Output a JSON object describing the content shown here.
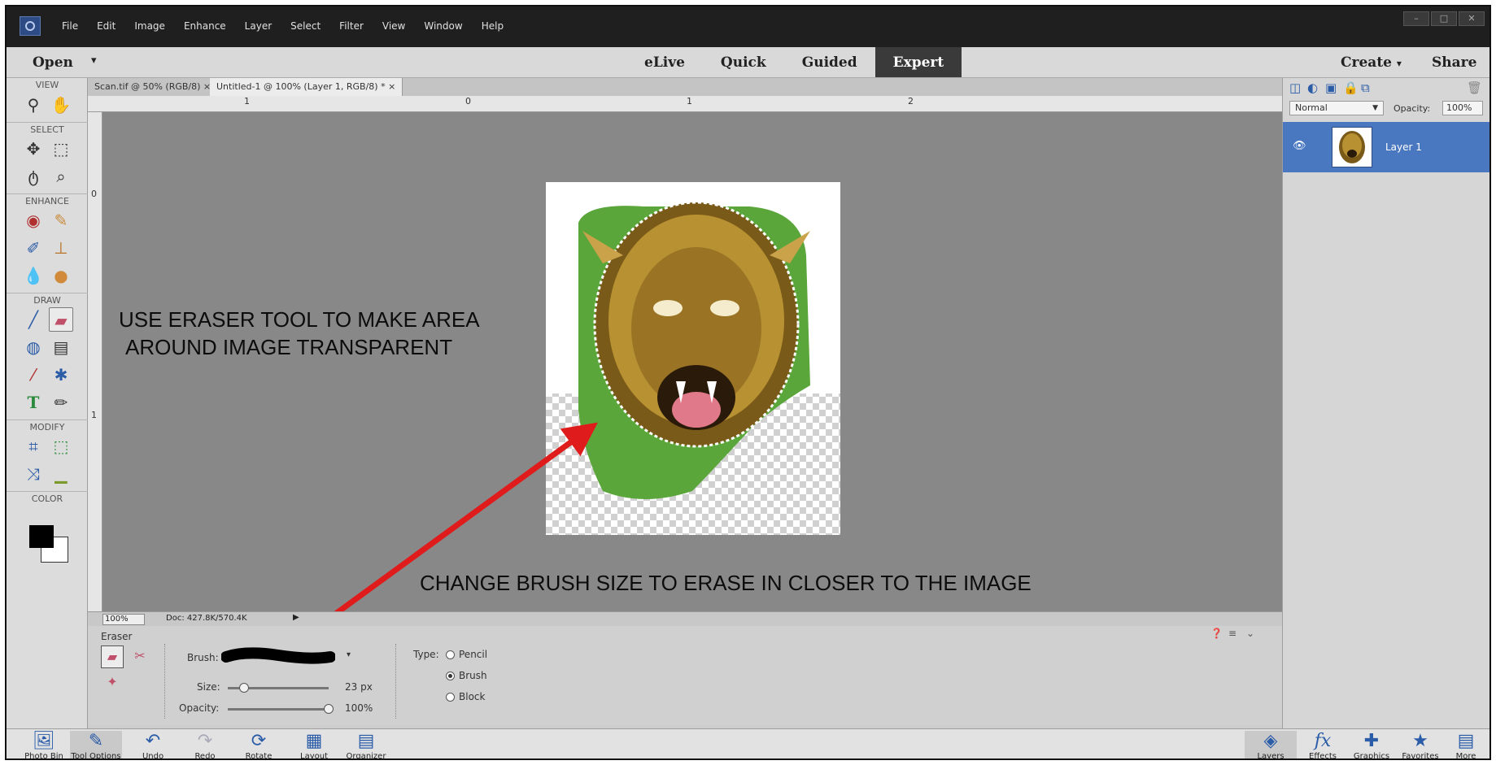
{
  "menubar": {
    "items": [
      "File",
      "Edit",
      "Image",
      "Enhance",
      "Layer",
      "Select",
      "Filter",
      "View",
      "Window",
      "Help"
    ]
  },
  "modebar": {
    "open_label": "Open",
    "modes": [
      "eLive",
      "Quick",
      "Guided",
      "Expert"
    ],
    "active_mode": "Expert",
    "create_label": "Create",
    "share_label": "Share"
  },
  "toolbox": {
    "sections": [
      "VIEW",
      "SELECT",
      "ENHANCE",
      "DRAW",
      "MODIFY",
      "COLOR"
    ]
  },
  "doctabs": [
    {
      "label": "Scan.tif @ 50% (RGB/8)"
    },
    {
      "label": "Untitled-1 @ 100% (Layer 1, RGB/8) *"
    }
  ],
  "ruler": {
    "top_ticks": [
      "1",
      "0",
      "1",
      "2"
    ],
    "left_ticks": [
      "0",
      "1"
    ]
  },
  "canvas": {
    "annotation_1_line1": "USE ERASER TOOL TO MAKE AREA",
    "annotation_1_line2": "AROUND IMAGE TRANSPARENT",
    "annotation_2": "CHANGE BRUSH SIZE TO ERASE IN CLOSER TO THE IMAGE",
    "arrow_color": "#e01b1b"
  },
  "statusbar": {
    "zoom": "100%",
    "doc": "Doc: 427.8K/570.4K"
  },
  "tool_options": {
    "tool_name": "Eraser",
    "brush_label": "Brush:",
    "size_label": "Size:",
    "size_value": "23 px",
    "opacity_label": "Opacity:",
    "opacity_value": "100%",
    "type_label": "Type:",
    "types": [
      "Pencil",
      "Brush",
      "Block"
    ],
    "selected_type": "Brush"
  },
  "layers_panel": {
    "blend_mode": "Normal",
    "opacity_label": "Opacity:",
    "opacity_value": "100%",
    "layer_name": "Layer 1"
  },
  "taskbar": {
    "left": [
      "Photo Bin",
      "Tool Options",
      "Undo",
      "Redo",
      "Rotate",
      "Layout",
      "Organizer"
    ],
    "right": [
      "Layers",
      "Effects",
      "Graphics",
      "Favorites",
      "More"
    ]
  },
  "colors": {
    "accent": "#4a78c0",
    "canvas_bg": "#888888",
    "menubar_bg": "#1f1f1f"
  }
}
